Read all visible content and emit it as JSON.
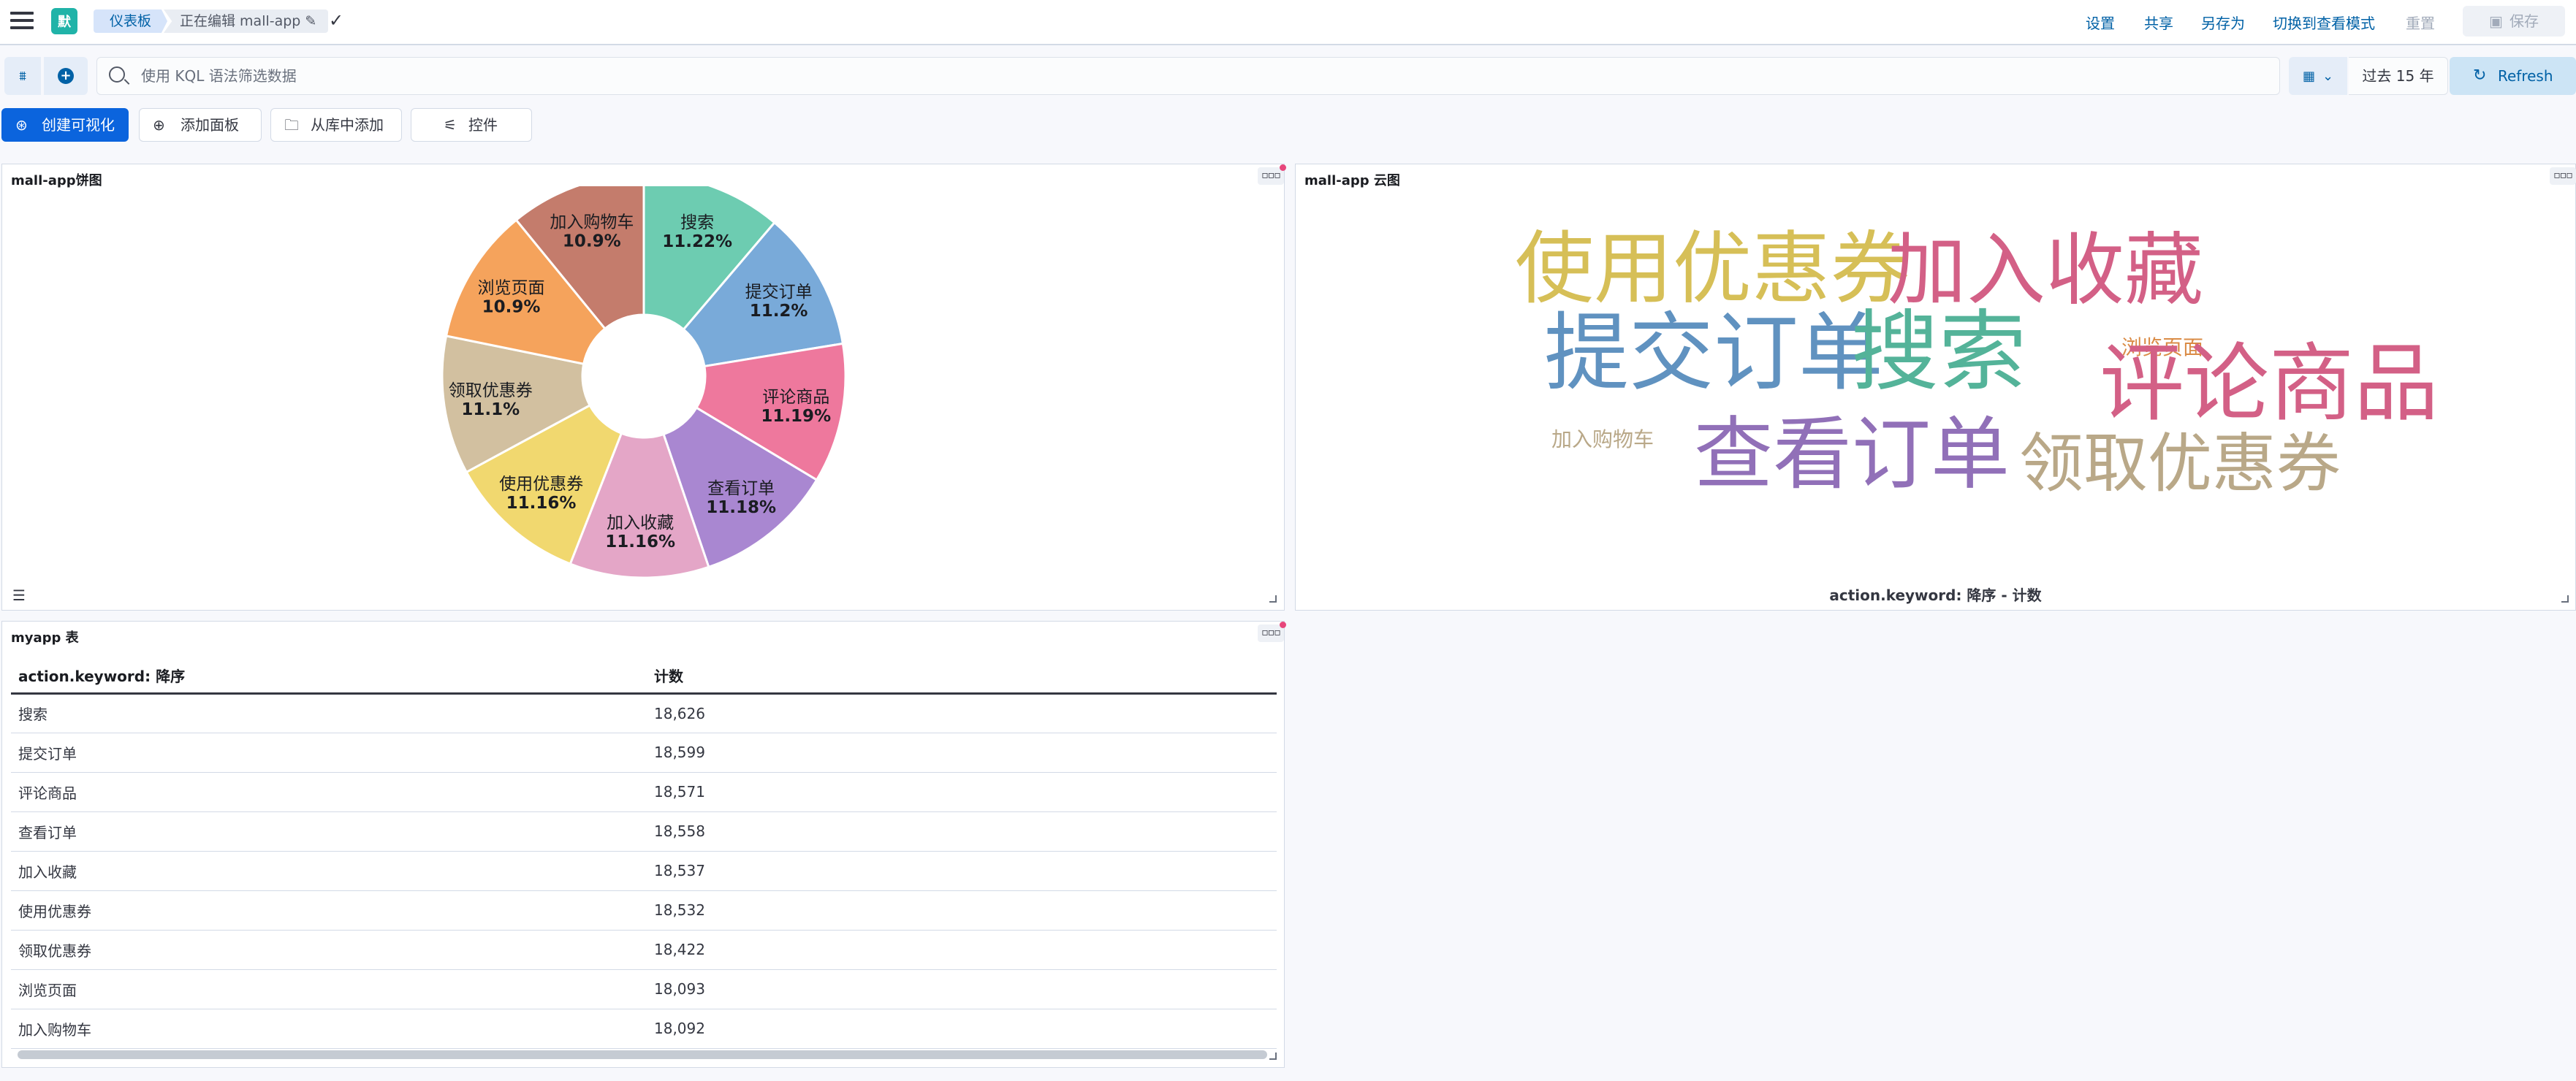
{
  "topbar": {
    "avatar_letter": "默",
    "breadcrumb": [
      "仪表板",
      "正在编辑 mall-app"
    ],
    "links": [
      "设置",
      "共享",
      "另存为",
      "切换到查看模式",
      "重置"
    ],
    "save_label": "保存"
  },
  "query": {
    "placeholder": "使用 KQL 语法筛选数据",
    "date_range": "过去 15 年",
    "refresh_label": "Refresh"
  },
  "toolbar": {
    "create_viz": "创建可视化",
    "add_panel": "添加面板",
    "add_from_library": "从库中添加",
    "controls": "控件"
  },
  "panels": {
    "pie_title": "mall-app饼图",
    "cloud_title": "mall-app 云图",
    "cloud_axis": "action.keyword: 降序 - 计数",
    "table_title": "myapp 表"
  },
  "colors": {
    "accent": "#0b64dd",
    "link": "#0061a6"
  },
  "chart_data": [
    {
      "type": "pie",
      "donut": true,
      "slices": [
        {
          "label": "搜索",
          "pct": "11.22%",
          "value": 11.22,
          "color": "#6dccb1"
        },
        {
          "label": "提交订单",
          "pct": "11.2%",
          "value": 11.2,
          "color": "#79aad9"
        },
        {
          "label": "评论商品",
          "pct": "11.19%",
          "value": 11.19,
          "color": "#ee789d"
        },
        {
          "label": "查看订单",
          "pct": "11.18%",
          "value": 11.18,
          "color": "#a987d1"
        },
        {
          "label": "加入收藏",
          "pct": "11.16%",
          "value": 11.16,
          "color": "#e4a6c7"
        },
        {
          "label": "使用优惠券",
          "pct": "11.16%",
          "value": 11.16,
          "color": "#f1d86f"
        },
        {
          "label": "领取优惠券",
          "pct": "11.1%",
          "value": 11.1,
          "color": "#d2c0a0"
        },
        {
          "label": "浏览页面",
          "pct": "10.9%",
          "value": 10.9,
          "color": "#f5a35c"
        },
        {
          "label": "加入购物车",
          "pct": "10.9%",
          "value": 10.9,
          "color": "#c47c6c"
        }
      ]
    },
    {
      "type": "table",
      "columns": [
        "action.keyword: 降序",
        "计数"
      ],
      "rows": [
        [
          "搜索",
          "18,626"
        ],
        [
          "提交订单",
          "18,599"
        ],
        [
          "评论商品",
          "18,571"
        ],
        [
          "查看订单",
          "18,558"
        ],
        [
          "加入收藏",
          "18,537"
        ],
        [
          "使用优惠券",
          "18,532"
        ],
        [
          "领取优惠券",
          "18,422"
        ],
        [
          "浏览页面",
          "18,093"
        ],
        [
          "加入购物车",
          "18,092"
        ]
      ]
    }
  ],
  "wordcloud": {
    "words": [
      {
        "text": "使用优惠券",
        "color": "#d6bf57",
        "size": "xl"
      },
      {
        "text": "加入收藏",
        "color": "#d36086",
        "size": "xl"
      },
      {
        "text": "提交订单",
        "color": "#6092c0",
        "size": "xl"
      },
      {
        "text": "搜索",
        "color": "#54b399",
        "size": "xl"
      },
      {
        "text": "浏览页面",
        "color": "#da8b45",
        "size": "sm"
      },
      {
        "text": "评论商品",
        "color": "#d36086",
        "size": "xl"
      },
      {
        "text": "加入购物车",
        "color": "#b9a888",
        "size": "sm"
      },
      {
        "text": "查看订单",
        "color": "#9170b8",
        "size": "xl"
      },
      {
        "text": "领取优惠券",
        "color": "#b9a888",
        "size": "xl"
      }
    ]
  }
}
